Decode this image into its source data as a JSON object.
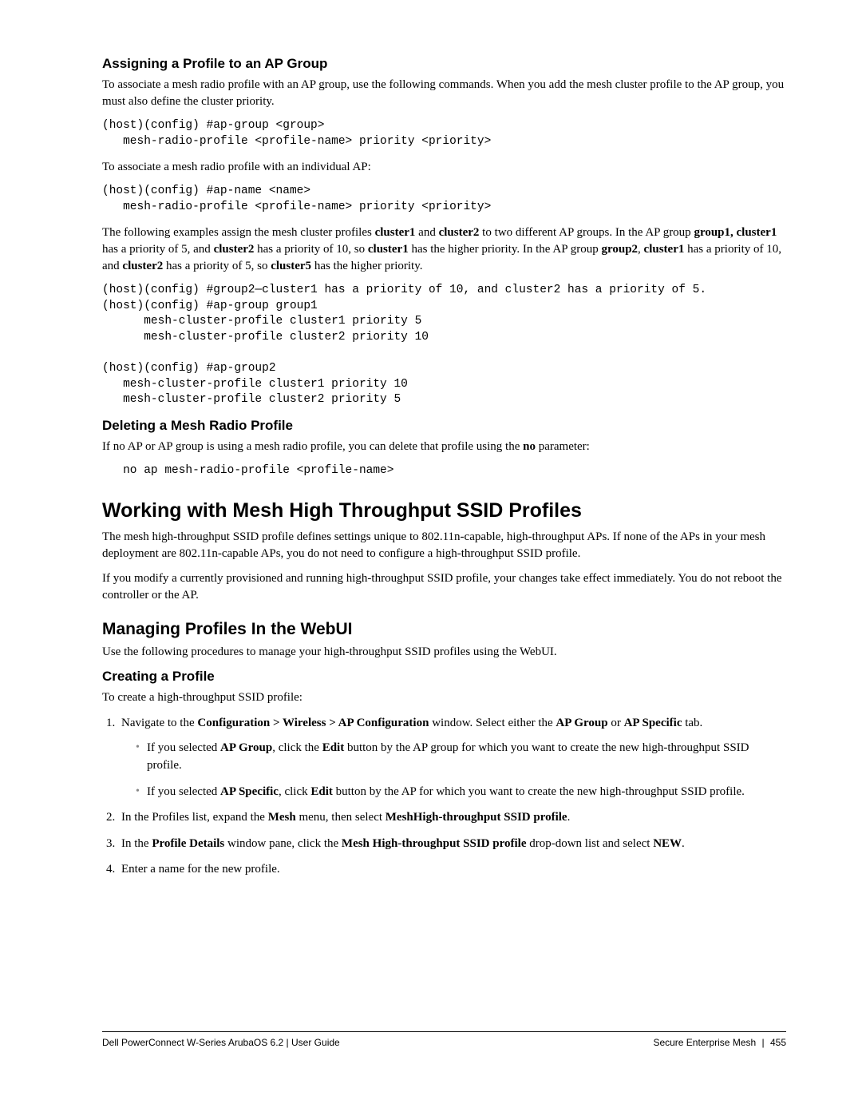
{
  "s1": {
    "h": "Assigning a Profile to an AP Group",
    "p1": "To associate a mesh radio profile with an AP group, use the following commands. When you add the mesh cluster profile to the AP group, you must also define the cluster priority.",
    "code1": "(host)(config) #ap-group <group>\n   mesh-radio-profile <profile-name> priority <priority>",
    "p2": "To associate a mesh radio profile with an individual AP:",
    "code2": "(host)(config) #ap-name <name>\n   mesh-radio-profile <profile-name> priority <priority>",
    "p3_a": "The following examples assign the mesh cluster profiles ",
    "p3_b": "cluster1",
    "p3_c": " and ",
    "p3_d": "cluster2",
    "p3_e": " to two different AP groups. In the AP group ",
    "p3_f": "group1, cluster1",
    "p3_g": " has a priority of 5, and ",
    "p3_h": "cluster2",
    "p3_i": " has a priority of 10, so ",
    "p3_j": "cluster1",
    "p3_k": " has the higher priority. In the AP group ",
    "p3_l": "group2",
    "p3_m": ", ",
    "p3_n": "cluster1",
    "p3_o": " has a priority of 10, and ",
    "p3_p": "cluster2",
    "p3_q": " has a priority of 5, so ",
    "p3_r": "cluster5",
    "p3_s": " has the higher priority.",
    "code3": "(host)(config) #group2—cluster1 has a priority of 10, and cluster2 has a priority of 5.\n(host)(config) #ap-group group1\n      mesh-cluster-profile cluster1 priority 5\n      mesh-cluster-profile cluster2 priority 10\n\n(host)(config) #ap-group2\n   mesh-cluster-profile cluster1 priority 10\n   mesh-cluster-profile cluster2 priority 5"
  },
  "s2": {
    "h": "Deleting a Mesh Radio Profile",
    "p1_a": "If no AP or AP group is using a mesh radio profile, you can delete that profile using the ",
    "p1_b": "no",
    "p1_c": " parameter:",
    "code1": "   no ap mesh-radio-profile <profile-name>"
  },
  "s3": {
    "h": "Working with Mesh High Throughput SSID Profiles",
    "p1": "The mesh high-throughput SSID profile defines settings unique to 802.11n-capable, high-throughput APs. If none of the APs in your mesh deployment are 802.11n-capable APs, you do not need to configure a high-throughput SSID profile.",
    "p2": "If you modify a currently provisioned and running high-throughput SSID profile, your changes take effect immediately. You do not reboot the controller or the AP."
  },
  "s4": {
    "h": "Managing Profiles In the WebUI",
    "p1": "Use the following procedures to manage your high-throughput SSID profiles using the WebUI."
  },
  "s5": {
    "h": "Creating a Profile",
    "p1": "To create a high-throughput SSID profile:",
    "li1_a": "Navigate to the ",
    "li1_b": "Configuration > Wireless > AP Configuration",
    "li1_c": " window. Select either the ",
    "li1_d": "AP Group",
    "li1_e": " or ",
    "li1_f": "AP Specific",
    "li1_g": " tab.",
    "b1_a": "If you selected ",
    "b1_b": "AP Group",
    "b1_c": ", click the ",
    "b1_d": "Edit",
    "b1_e": " button by the AP group for which you want to create the new high-throughput SSID profile.",
    "b2_a": "If you selected ",
    "b2_b": "AP Specific",
    "b2_c": ", click ",
    "b2_d": "Edit",
    "b2_e": " button by the AP for which you want to create the new high-throughput SSID profile.",
    "li2_a": "In the Profiles list, expand the ",
    "li2_b": "Mesh",
    "li2_c": " menu, then select ",
    "li2_d": "MeshHigh-throughput SSID profile",
    "li2_e": ".",
    "li3_a": "In the ",
    "li3_b": "Profile Details",
    "li3_c": " window pane, click the ",
    "li3_d": "Mesh High-throughput SSID profile",
    "li3_e": " drop-down list and select ",
    "li3_f": "NEW",
    "li3_g": ".",
    "li4": "Enter a name for the new profile."
  },
  "footer": {
    "left": "Dell PowerConnect W-Series ArubaOS 6.2",
    "left2": "User Guide",
    "right1": "Secure Enterprise Mesh",
    "right2": "455"
  }
}
